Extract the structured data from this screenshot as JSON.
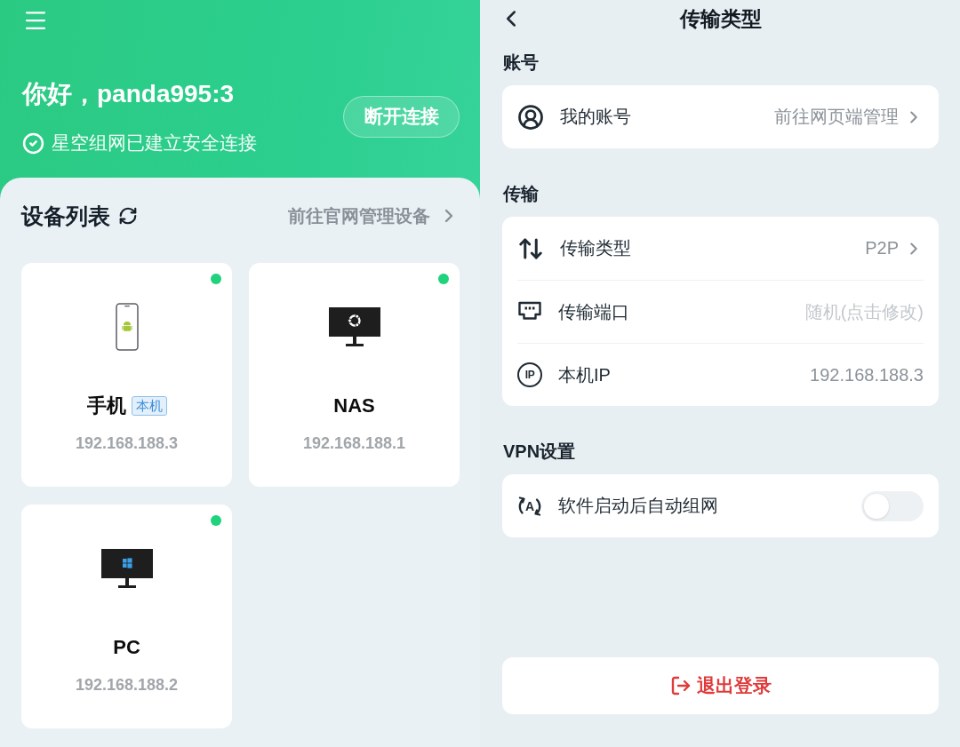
{
  "home": {
    "greeting": "你好，panda995:3",
    "status": "星空组网已建立安全连接",
    "disconnect_button": "断开连接",
    "device_list": {
      "title": "设备列表",
      "manage_link": "前往官网管理设备",
      "devices": [
        {
          "name": "手机",
          "badge": "本机",
          "ip": "192.168.188.3",
          "online": true
        },
        {
          "name": "NAS",
          "ip": "192.168.188.1",
          "online": true
        },
        {
          "name": "PC",
          "ip": "192.168.188.2",
          "online": true
        }
      ]
    }
  },
  "settings": {
    "title": "传输类型",
    "sections": [
      {
        "title": "账号",
        "rows": [
          {
            "kind": "link",
            "label": "我的账号",
            "value": "前往网页端管理"
          }
        ]
      },
      {
        "title": "传输",
        "rows": [
          {
            "kind": "link",
            "label": "传输类型",
            "value": "P2P"
          },
          {
            "kind": "hint",
            "label": "传输端口",
            "value": "随机(点击修改)"
          },
          {
            "kind": "value",
            "icon_text": "IP",
            "label": "本机IP",
            "value": "192.168.188.3"
          }
        ]
      },
      {
        "title": "VPN设置",
        "rows": [
          {
            "kind": "switch",
            "icon_text": "A",
            "label": "软件启动后自动组网",
            "on": false
          }
        ]
      }
    ],
    "logout_button": "退出登录"
  }
}
